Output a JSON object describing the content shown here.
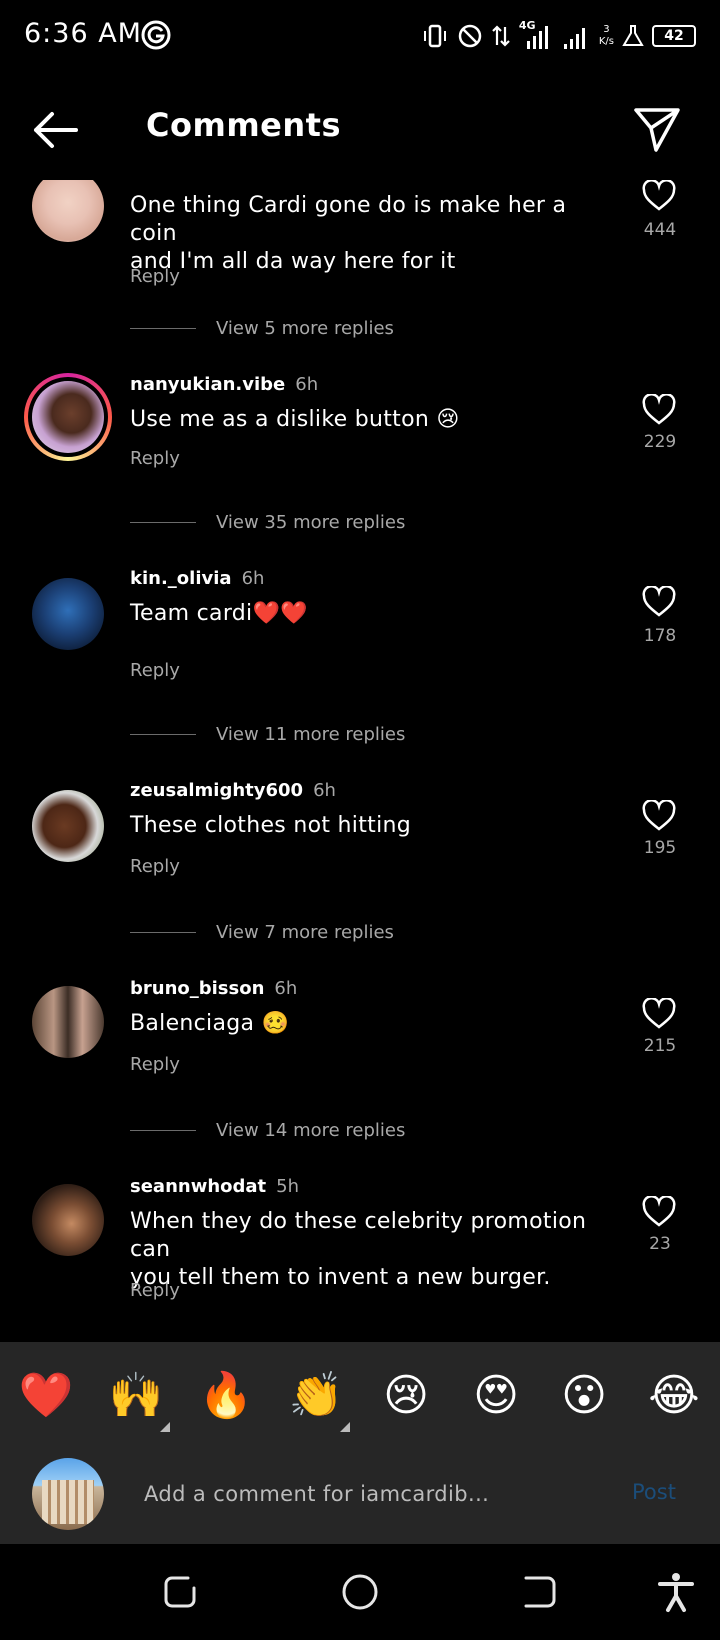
{
  "status": {
    "time": "6:36 AM",
    "network": "4G",
    "speed_value": "3",
    "speed_unit": "K/s",
    "battery": "42"
  },
  "header": {
    "title": "Comments"
  },
  "comments": [
    {
      "text_line1": "One thing Cardi gone do is make her a coin",
      "text_line2": "and I'm all da way here for it",
      "reply": "Reply",
      "likes": "444",
      "more_replies": "View 5 more replies"
    },
    {
      "user": "nanyukian.vibe",
      "time": "6h",
      "text": "Use me as a dislike button 😢",
      "reply": "Reply",
      "likes": "229",
      "more_replies": "View 35 more replies"
    },
    {
      "user": "kin._olivia",
      "time": "6h",
      "text": "Team cardi❤️❤️",
      "reply": "Reply",
      "likes": "178",
      "more_replies": "View 11 more replies"
    },
    {
      "user": "zeusalmighty600",
      "time": "6h",
      "text": "These clothes not hitting",
      "reply": "Reply",
      "likes": "195",
      "more_replies": "View 7 more replies"
    },
    {
      "user": "bruno_bisson",
      "time": "6h",
      "text": "Balenciaga 🥴",
      "reply": "Reply",
      "likes": "215",
      "more_replies": "View 14 more replies"
    },
    {
      "user": "seannwhodat",
      "time": "5h",
      "text_line1": "When they do these celebrity promotion can",
      "text_line2": "you tell them to invent a new burger.",
      "reply": "Reply",
      "likes": "23"
    }
  ],
  "emoji_bar": [
    "❤️",
    "🙌",
    "🔥",
    "👏",
    "😢",
    "😍",
    "😮",
    "😂"
  ],
  "composer": {
    "placeholder": "Add a comment for iamcardib...",
    "post_label": "Post"
  },
  "colors": {
    "background": "#000000",
    "panel": "#262626",
    "secondary_text": "#a8a8a8",
    "post_disabled": "#1b4d7a",
    "heart_red": "#ed2a2a"
  }
}
